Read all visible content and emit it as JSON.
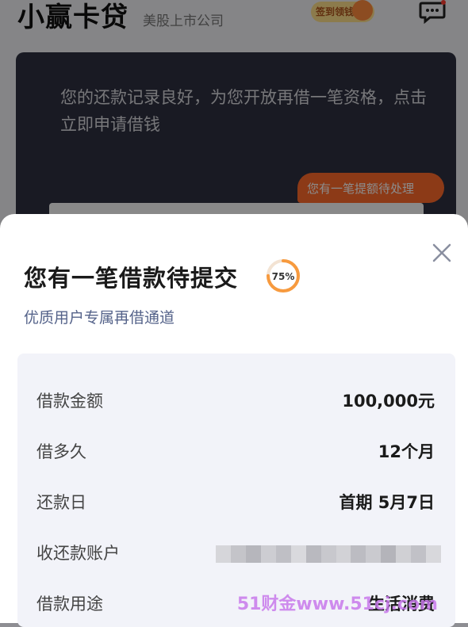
{
  "app": {
    "title": "小赢卡贷",
    "subtitle": "美股上市公司",
    "signin_badge": "签到领钱"
  },
  "banner": {
    "message": "您的还款记录良好，为您开放再借一笔资格，点击立即申请借钱",
    "pending_tag": "您有一笔提额待处理"
  },
  "sheet": {
    "title": "您有一笔借款待提交",
    "progress_label": "75%",
    "progress": 0.75,
    "subtitle": "优质用户专属再借通道",
    "rows": [
      {
        "label": "借款金额",
        "value": "100,000元"
      },
      {
        "label": "借多久",
        "value": "12个月"
      },
      {
        "label": "还款日",
        "value": "首期 5月7日"
      },
      {
        "label": "收还款账户",
        "value": ""
      },
      {
        "label": "借款用途",
        "value": "生活消费"
      }
    ]
  },
  "watermark": "51财金www.51cj.com",
  "colors": {
    "accent_orange": "#ff6a2b",
    "ring_orange": "#f79a3e",
    "subtitle_blue": "#55638a",
    "dark_card": "#2e3140"
  },
  "icons": {
    "close": "close-icon",
    "message": "message-bubble-icon"
  }
}
